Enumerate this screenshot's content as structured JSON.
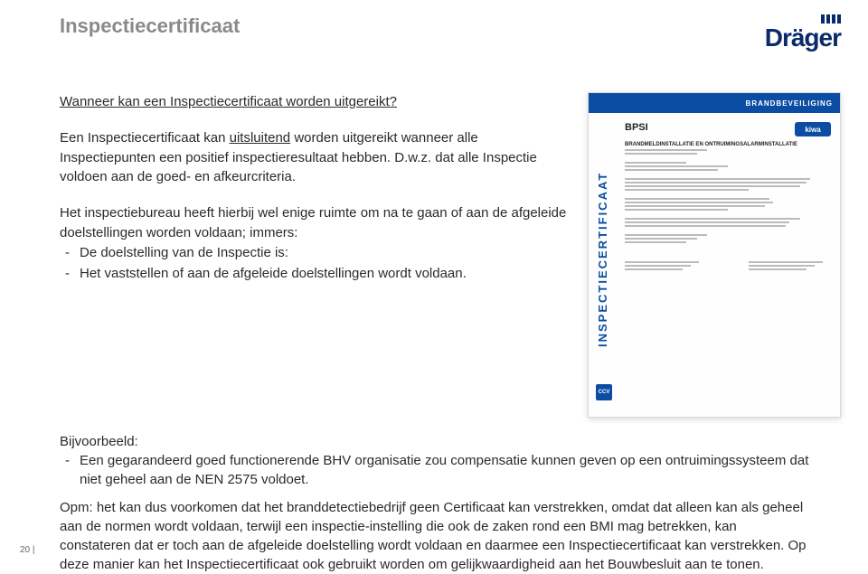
{
  "header": {
    "doc_title": "Inspectiecertificaat",
    "logo_text": "Dräger"
  },
  "main": {
    "section_title": "Wanneer kan een Inspectiecertificaat worden uitgereikt?",
    "p1_a": "Een Inspectiecertificaat kan ",
    "p1_underline": "uitsluitend",
    "p1_b": " worden uitgereikt wanneer alle Inspectiepunten een positief inspectieresultaat hebben. D.w.z. dat alle Inspectie voldoen aan de goed- en afkeurcriteria.",
    "p2": "Het inspectiebureau heeft hierbij wel enige ruimte om na te gaan of aan de afgeleide doelstellingen worden voldaan; immers:",
    "p2_bullets": [
      "De doelstelling van de Inspectie is:",
      "Het vaststellen of aan de afgeleide doelstellingen wordt voldaan."
    ]
  },
  "lower": {
    "example_label": "Bijvoorbeeld:",
    "example_bullet": "Een gegarandeerd goed functionerende BHV organisatie zou compensatie kunnen geven op een ontruimingssysteem dat niet geheel aan de NEN 2575 voldoet.",
    "opm": "Opm: het kan dus voorkomen dat het branddetectiebedrijf geen Certificaat kan verstrekken, omdat dat alleen kan als geheel aan de normen wordt voldaan, terwijl een inspectie-instelling die ook de zaken rond een BMI mag betrekken, kan constateren dat er toch aan de afgeleide doelstelling wordt voldaan en daarmee een Inspectiecertificaat kan verstrekken. Op deze manier kan het Inspectiecertificaat ook gebruikt worden om gelijkwaardigheid aan het Bouwbesluit aan te tonen."
  },
  "cert": {
    "top_bar": "BRANDBEVEILIGING",
    "side_text": "INSPECTIECERTIFICAAT",
    "bpsi": "BPSI",
    "kiwa": "kiwa",
    "subtitle": "BRANDMELDINSTALLATIE EN ONTRUIMINGSALARMINSTALLATIE",
    "ccv": "CCV"
  },
  "footer": {
    "page": "20 |"
  }
}
